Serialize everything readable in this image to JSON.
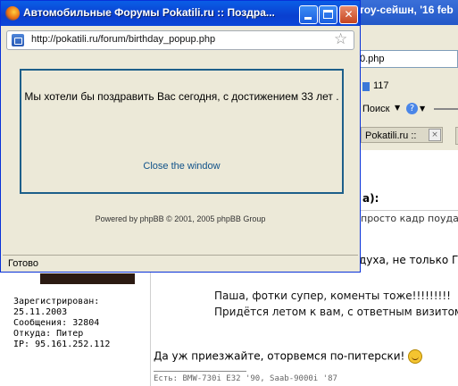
{
  "background": {
    "window_title": "тоу-сейшн, '16 feb",
    "url_fragment": "0.php",
    "counter": "117",
    "search_label": "Поиск",
    "tab_label": "Pokatili.ru ::",
    "author_suffix": "а):",
    "post_header": "просто кадр поудач",
    "post_line1": "духа, не только Г",
    "profile": {
      "registered_label": "Зарегистрирован:",
      "registered_date": "25.11.2003",
      "messages": "Сообщения: 32804",
      "location": "Откуда: Питер",
      "ip": "IP: 95.161.252.112"
    },
    "message_lines": [
      "Паша, фотки супер, коменты тоже!!!!!!!!!",
      "Придётся летом к вам, с ответным визитом"
    ],
    "reply": "Да уж приезжайте, оторвемся по-питерски!",
    "signature": "Есть: BMW-730i E32 '90, Saab-9000i '87"
  },
  "popup": {
    "title": "Автомобильные Форумы Pokatili.ru :: Поздра...",
    "url": "http://pokatili.ru/forum/birthday_popup.php",
    "message": "Мы хотели бы поздравить Вас сегодня, с достижением 33 лет .",
    "close_link": "Close the window",
    "powered_by": "Powered by phpBB © 2001, 2005 phpBB Group",
    "status": "Готово"
  }
}
